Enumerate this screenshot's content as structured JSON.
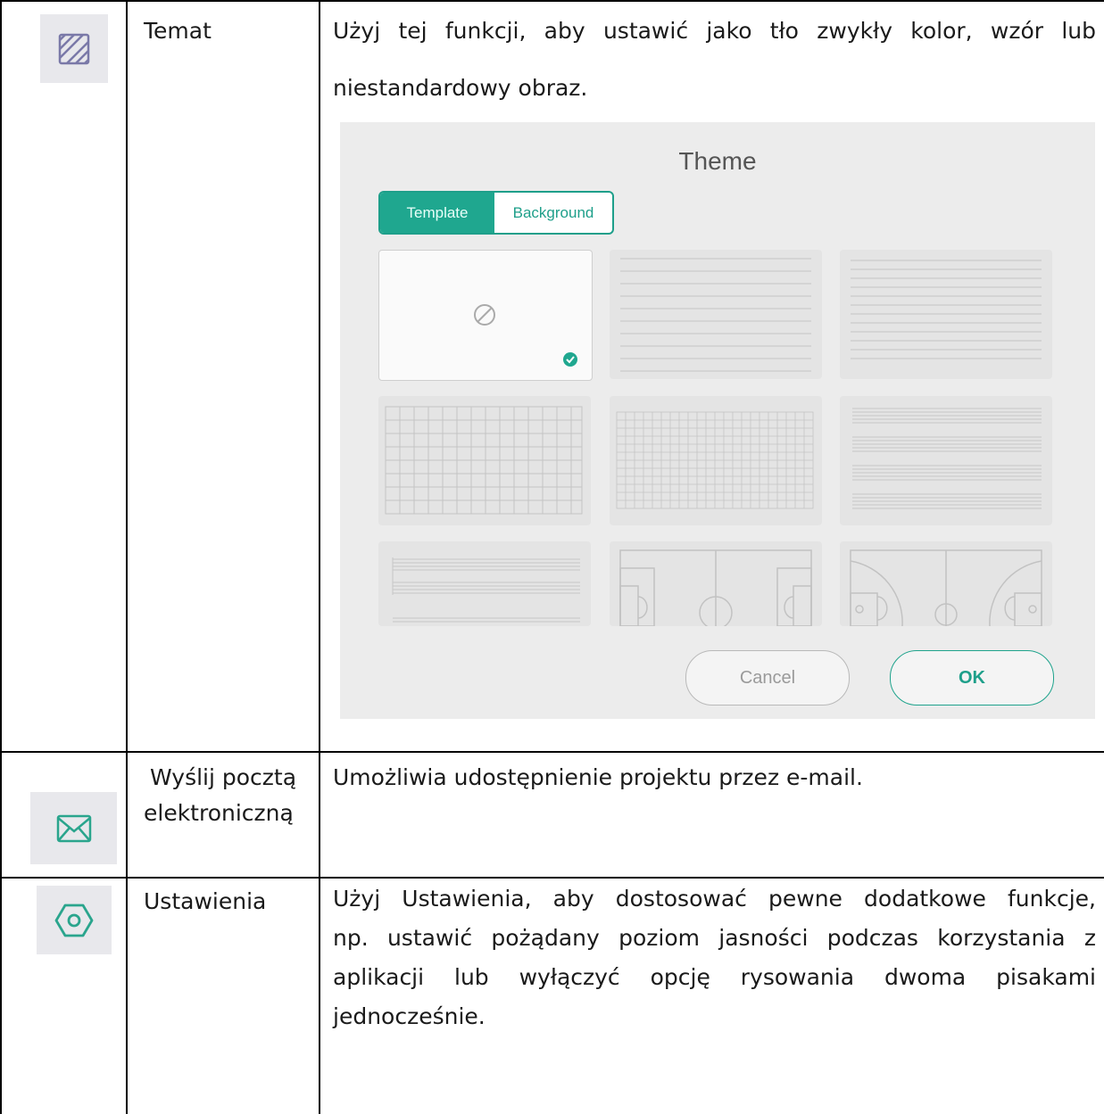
{
  "rows": [
    {
      "icon": "hatched-square-icon",
      "name": "Temat",
      "description": "Użyj tej funkcji, aby ustawić jako tło zwykły kolor, wzór lub niestandardowy obraz."
    },
    {
      "icon": "envelope-icon",
      "name_line1": "Wyślij pocztą",
      "name_line2": "elektroniczną",
      "description": "Umożliwia udostępnienie projektu przez e-mail."
    },
    {
      "icon": "hexagon-settings-icon",
      "name": "Ustawienia",
      "description": "Użyj Ustawienia, aby dostosować pewne dodatkowe funkcje, np. ustawić pożądany poziom jasności podczas korzystania z aplikacji lub wyłączyć opcję rysowania dwoma pisakami jednocześnie."
    }
  ],
  "theme_dialog": {
    "title": "Theme",
    "tabs": {
      "active": "Template",
      "inactive": "Background"
    },
    "cancel": "Cancel",
    "ok": "OK",
    "accent": "#1fa78f"
  },
  "desc_line1": "Użyj tej funkcji, aby ustawić jako tło zwykły kolor, wzór lub",
  "desc_line2": "niestandardowy obraz.",
  "settings_lines": [
    "Użyj Ustawienia, aby dostosować pewne dodatkowe funkcje,",
    "np. ustawić pożądany poziom jasności podczas korzystania z",
    "aplikacji lub wyłączyć opcję rysowania dwoma pisakami",
    "jednocześnie."
  ]
}
